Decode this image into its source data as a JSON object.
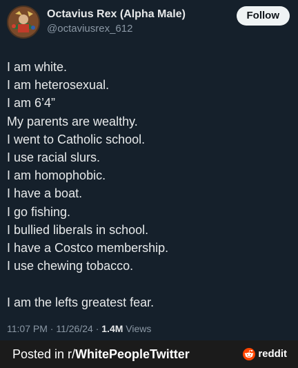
{
  "tweet": {
    "author": {
      "display_name": "Octavius Rex (Alpha Male)",
      "handle": "@octaviusrex_612"
    },
    "follow_label": "Follow",
    "lines": [
      "I am white.",
      "I am heterosexual.",
      "I am 6’4”",
      "My parents are wealthy.",
      "I went to Catholic school.",
      "I use racial slurs.",
      "I am homophobic.",
      "I have a boat.",
      "I go fishing.",
      "I bullied liberals in school.",
      "I have a Costco membership.",
      "I use chewing tobacco.",
      "",
      "I am the lefts greatest fear."
    ],
    "meta": {
      "time": "11:07 PM",
      "separator": "·",
      "date": "11/26/24",
      "views_count": "1.4M",
      "views_label": "Views"
    }
  },
  "footer": {
    "prefix": "Posted in r/",
    "subreddit": "WhitePeopleTwitter",
    "brand": "reddit",
    "brand_icon": "reddit-snoo-icon"
  },
  "colors": {
    "background": "#15202b",
    "text": "#e7e9ea",
    "muted": "#8b98a5",
    "follow_bg": "#eff3f4",
    "footer_bg": "#1b1b1b",
    "reddit_orange": "#ff4500"
  }
}
